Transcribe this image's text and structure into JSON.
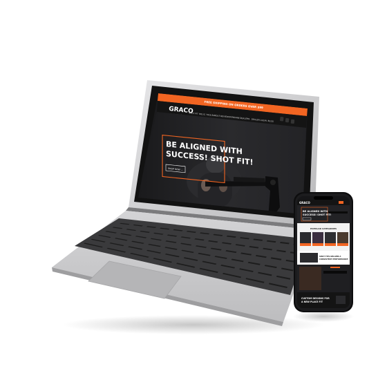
{
  "laptop_site": {
    "announcement": "FREE SHIPPING ON ORDERS OVER $99",
    "logo": "GRACO",
    "logo_tagline": "CORPORATION",
    "nav": [
      "SHOT FIT",
      "RELIC",
      "TOOLS",
      "ABOUT",
      "REVIEWS",
      "FIREARM DEALERS",
      "DEALER LOGIN",
      "BLOG"
    ],
    "hero_line1": "BE ALIGNED WITH",
    "hero_line2": "SUCCESS! SHOT FIT!",
    "hero_button": "SHOP NOW  →"
  },
  "phone_site": {
    "logo": "GRACO",
    "hero_line1": "BE ALIGNED WITH",
    "hero_line2": "SUCCESS! SHOT FIT!",
    "section_title": "POPULAR CATEGORIES",
    "feature_line1": "SHOT FITS DELIVER A",
    "feature_line2": "CONSISTENT PERFORMANCE",
    "footer_line1": "CUSTOM DESIGNS FOR",
    "footer_line2": "A NEW PLACE FIT"
  },
  "colors": {
    "accent": "#f26522",
    "site_bg": "#1b1b1d",
    "bezel": "#121212",
    "aluminum": "#c8c8ca",
    "key": "#1c1c1c"
  }
}
